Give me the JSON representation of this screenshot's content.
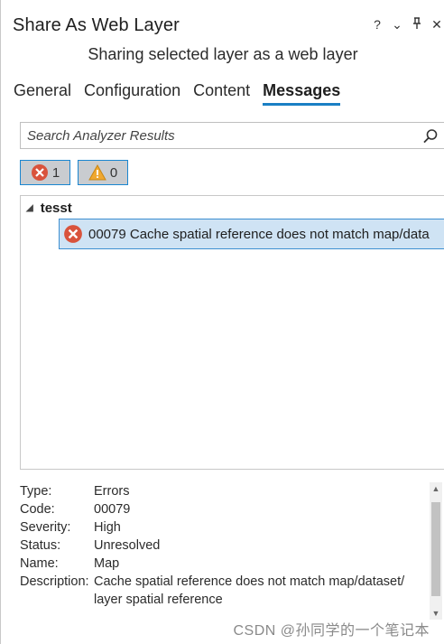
{
  "window": {
    "title": "Share As Web Layer",
    "controls": [
      "?",
      "⌄",
      "⊥",
      "✕"
    ]
  },
  "subtitle": "Sharing selected layer as a web layer",
  "tabs": [
    {
      "label": "General"
    },
    {
      "label": "Configuration"
    },
    {
      "label": "Content"
    },
    {
      "label": "Messages",
      "active": true
    }
  ],
  "search": {
    "placeholder": "Search Analyzer Results",
    "icon": "search-icon"
  },
  "filters": {
    "errors": {
      "count": "1",
      "icon": "error-icon"
    },
    "warnings": {
      "count": "0",
      "icon": "warning-icon"
    }
  },
  "results": {
    "group": "tesst",
    "message": "00079 Cache spatial reference does not match map/data"
  },
  "details": {
    "type_label": "Type:",
    "type_value": "Errors",
    "code_label": "Code:",
    "code_value": "00079",
    "severity_label": "Severity:",
    "severity_value": "High",
    "status_label": "Status:",
    "status_value": "Unresolved",
    "name_label": "Name:",
    "name_value": "Map",
    "description_label": "Description:",
    "description_value": "Cache spatial reference does not match map/dataset/ layer spatial reference"
  },
  "watermark": "CSDN @孙同学的一个笔记本",
  "colors": {
    "accent": "#1a7fc4",
    "selected_row": "#cfe3f4",
    "error": "#d9533c",
    "warning": "#f0a830"
  }
}
